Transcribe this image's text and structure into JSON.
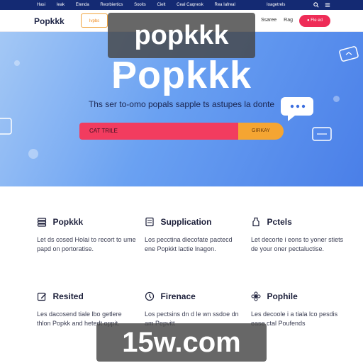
{
  "topbar": {
    "links": [
      "Hasi",
      "Ieak",
      "Etenda",
      "Reorbiertics",
      "Sooits",
      "Cielt",
      "Ceal Caqnesk",
      "Rea Iafreal"
    ],
    "lang": "Ioagetrels"
  },
  "nav": {
    "logo": "Popkkk",
    "active_item": "Ivpbs",
    "right_items": [
      "Ssaree",
      "Rag"
    ],
    "cta": "Fle ed"
  },
  "watermarks": {
    "top": "popkkk",
    "bottom": "15w.com"
  },
  "hero": {
    "title": "Popkkk",
    "subtitle": "Ths ser to-omo popals sapple ts astupes la donte",
    "input_value": "CAT TRILE",
    "button": "GIRKAY"
  },
  "features": [
    {
      "title": "Popkkk",
      "text": "Let ds cosed Holai to recort to ume papd on portoratise.",
      "icon": "stack-icon"
    },
    {
      "title": "Supplication",
      "text": "Los pecctina diecofate pactecd ene Popkkt lactie lnagon.",
      "icon": "document-icon"
    },
    {
      "title": "Pctels",
      "text": "Let decorte i eons to yoner stiets de your oner pectaluctise.",
      "icon": "bottle-icon"
    },
    {
      "title": "Resited",
      "text": "Les dacosend tiale lbo getlere thlon Popkk and hetedt oppit.",
      "icon": "edit-icon"
    },
    {
      "title": "Firenace",
      "text": "Los pectsins dn d le wn ssdoe dn am Pepvitt",
      "icon": "clock-icon"
    },
    {
      "title": "Pophile",
      "text": "Les decoole i a tiala lco pesdis ease ctal Poufends",
      "icon": "flower-icon"
    }
  ],
  "colors": {
    "topbar": "#142a73",
    "accent_orange": "#f5a532",
    "accent_red": "#f23c5f",
    "cta": "#ee2c57",
    "hero_gradient_start": "#a4c8f5",
    "hero_gradient_end": "#4a7fe8"
  }
}
